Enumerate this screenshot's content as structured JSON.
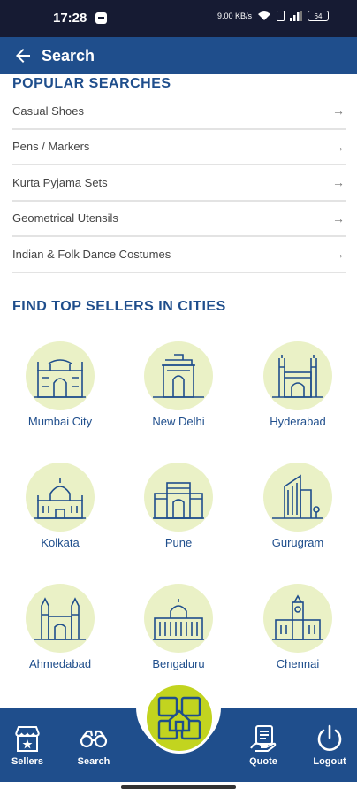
{
  "status": {
    "time": "17:28",
    "speed": "9.00 KB/s",
    "battery": "64"
  },
  "header": {
    "title": "Search",
    "back_icon": "arrow-left-icon"
  },
  "popular": {
    "title": "POPULAR SEARCHES",
    "items": [
      {
        "label": "Casual Shoes"
      },
      {
        "label": "Pens / Markers"
      },
      {
        "label": "Kurta Pyjama Sets"
      },
      {
        "label": "Geometrical Utensils"
      },
      {
        "label": "Indian & Folk Dance Costumes"
      }
    ],
    "arrow": "→"
  },
  "cities": {
    "title": "FIND TOP SELLERS IN CITIES",
    "items": [
      {
        "name": "Mumbai City",
        "icon": "gateway-of-india-icon"
      },
      {
        "name": "New Delhi",
        "icon": "india-gate-icon"
      },
      {
        "name": "Hyderabad",
        "icon": "charminar-icon"
      },
      {
        "name": "Kolkata",
        "icon": "victoria-memorial-icon"
      },
      {
        "name": "Pune",
        "icon": "shaniwar-wada-icon"
      },
      {
        "name": "Gurugram",
        "icon": "skyscraper-icon"
      },
      {
        "name": "Ahmedabad",
        "icon": "temple-icon"
      },
      {
        "name": "Bengaluru",
        "icon": "vidhana-soudha-icon"
      },
      {
        "name": "Chennai",
        "icon": "central-station-icon"
      }
    ]
  },
  "nav": {
    "items": [
      {
        "label": "Sellers",
        "icon": "store-icon"
      },
      {
        "label": "Search",
        "icon": "binoculars-icon"
      },
      {
        "label": "Quote",
        "icon": "quote-icon"
      },
      {
        "label": "Logout",
        "icon": "power-icon"
      }
    ],
    "center_icon": "home-grid-icon"
  },
  "colors": {
    "primary": "#1f4e8c",
    "accent": "#c2d41f",
    "city_circle": "#eaf1c6",
    "status_bar": "#161b33"
  }
}
